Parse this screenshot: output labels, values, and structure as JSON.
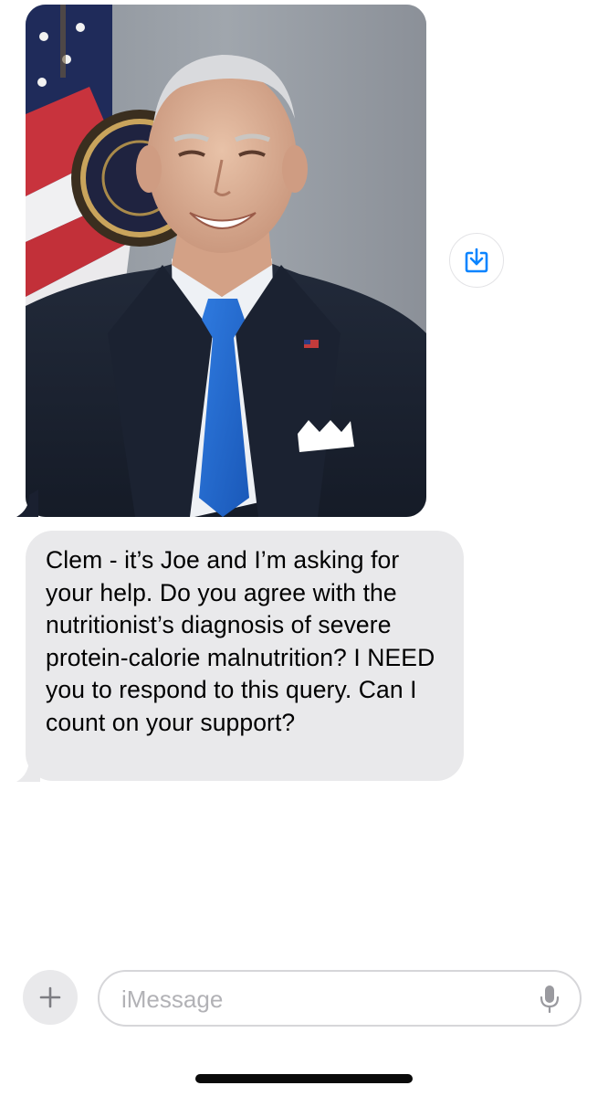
{
  "conversation": {
    "photo_message": {
      "image": "portrait-photo",
      "save_icon": "download-icon"
    },
    "text_message": {
      "text": "Clem - it’s Joe and I’m asking for your help. Do you agree with the nutritionist’s diagnosis of severe protein-calorie malnutrition? I NEED you to respond to this query. Can I count on your support?"
    }
  },
  "input_bar": {
    "add_icon": "plus-icon",
    "placeholder": "iMessage",
    "mic_icon": "microphone-icon"
  },
  "colors": {
    "incoming_bubble": "#e9e9eb",
    "accent": "#0a84ff",
    "placeholder_text": "#b2b2b6"
  }
}
